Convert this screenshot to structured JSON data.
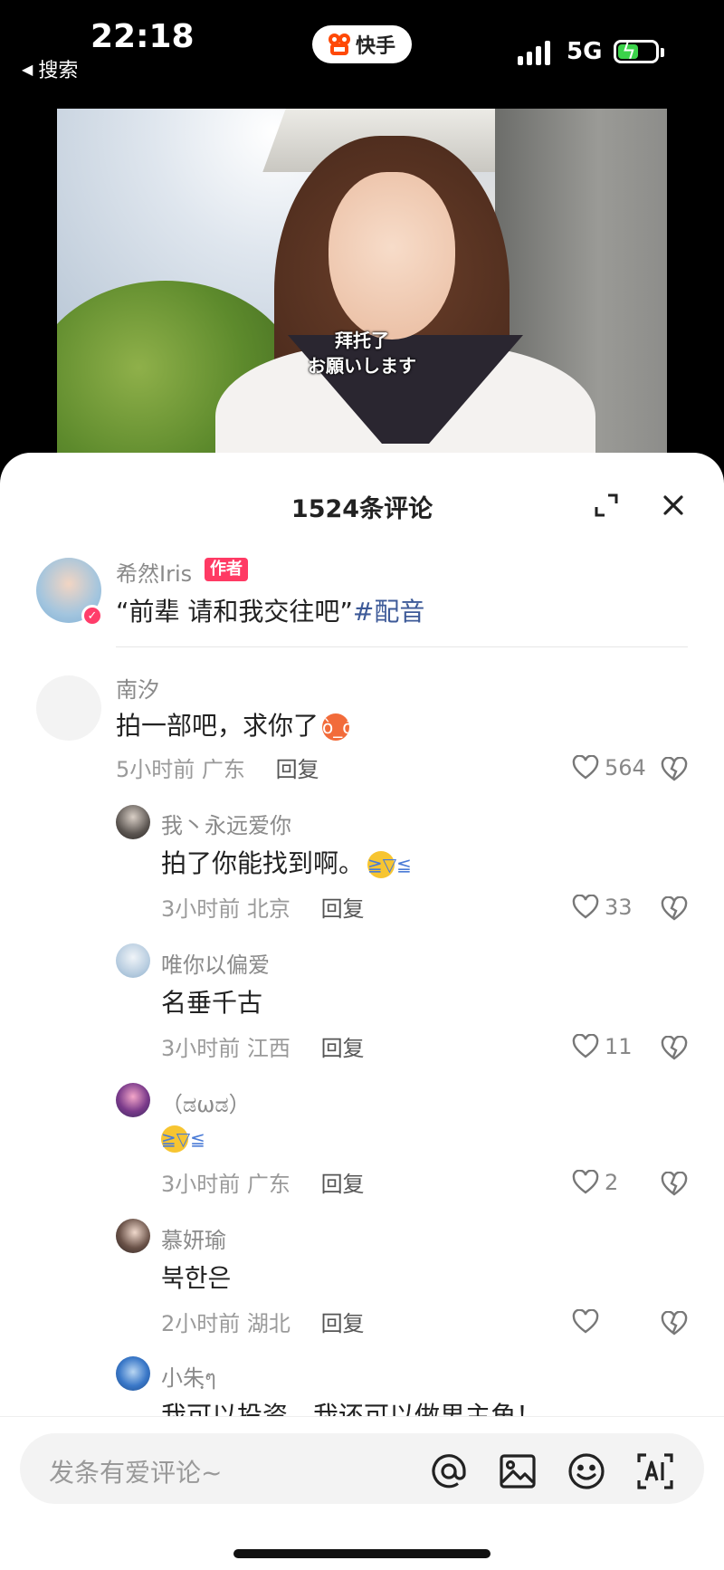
{
  "status_bar": {
    "time": "22:18",
    "back_label": "搜索",
    "app_name": "快手",
    "network": "5G"
  },
  "video": {
    "subtitle_cn": "拜托了",
    "subtitle_jp": "お願いします"
  },
  "sheet": {
    "title": "1524条评论"
  },
  "author_post": {
    "username": "希然Iris",
    "badge": "作者",
    "text": "“前辈 请和我交往吧”",
    "hashtag": "#配音"
  },
  "comments": [
    {
      "username": "南汐",
      "text": "拍一部吧，求你了",
      "emoji": "angry-face-icon",
      "time": "5小时前",
      "location": "广东",
      "reply": "回复",
      "likes": "564"
    },
    {
      "username": "我丶永远爱你",
      "text": "拍了你能找到啊。",
      "emoji": "laughing-crying-icon",
      "time": "3小时前",
      "location": "北京",
      "reply": "回复",
      "likes": "33"
    },
    {
      "username": "唯你以偏爱",
      "text": "名垂千古",
      "time": "3小时前",
      "location": "江西",
      "reply": "回复",
      "likes": "11"
    },
    {
      "username": "（ಡωಡ）",
      "text": "",
      "emoji": "tears-of-joy-icon",
      "time": "3小时前",
      "location": "广东",
      "reply": "回复",
      "likes": "2"
    },
    {
      "username": "慕妍瑜",
      "text": "북한은",
      "time": "2小时前",
      "location": "湖北",
      "reply": "回复",
      "likes": ""
    },
    {
      "username": "小朱ฺๆ",
      "text": "我可以投资，我还可以做男主角！",
      "time": "",
      "location": "",
      "reply": "",
      "likes": ""
    }
  ],
  "input": {
    "placeholder": "发条有爱评论~"
  },
  "colors": {
    "author_badge": "#ff3a64",
    "hashtag": "#3d5a98",
    "brand": "#ff4906"
  }
}
